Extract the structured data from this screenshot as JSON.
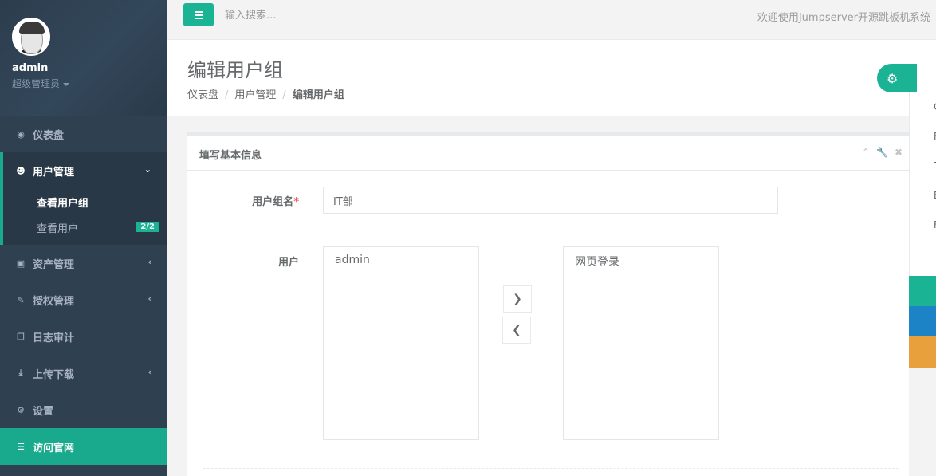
{
  "user": {
    "name": "admin",
    "role": "超级管理员"
  },
  "sidebar": {
    "items": [
      {
        "label": "仪表盘"
      },
      {
        "label": "用户管理"
      },
      {
        "label": "资产管理"
      },
      {
        "label": "授权管理"
      },
      {
        "label": "日志审计"
      },
      {
        "label": "上传下载"
      },
      {
        "label": "设置"
      },
      {
        "label": "访问官网"
      }
    ],
    "sub_items": [
      {
        "label": "查看用户组"
      },
      {
        "label": "查看用户",
        "badge": "2/2"
      }
    ]
  },
  "topbar": {
    "search_placeholder": "输入搜索...",
    "welcome": "欢迎使用Jumpserver开源跳板机系统"
  },
  "page": {
    "title": "编辑用户组",
    "breadcrumb": [
      "仪表盘",
      "用户管理",
      "编辑用户组"
    ]
  },
  "right_panel": {
    "letters": [
      "C",
      "F",
      "T",
      "E",
      "F"
    ]
  },
  "form": {
    "section_title": "填写基本信息",
    "group_name_label": "用户组名",
    "required_mark": "*",
    "group_name_value": "IT部",
    "users_label": "用户",
    "available_users": [
      "admin"
    ],
    "selected_users": [
      "网页登录"
    ]
  },
  "colors": {
    "sidebar_bg": "#2f4050",
    "accent": "#1ab394",
    "skin_green": "#1ab394",
    "skin_blue": "#1c84c6",
    "skin_orange": "#e8a03c"
  }
}
